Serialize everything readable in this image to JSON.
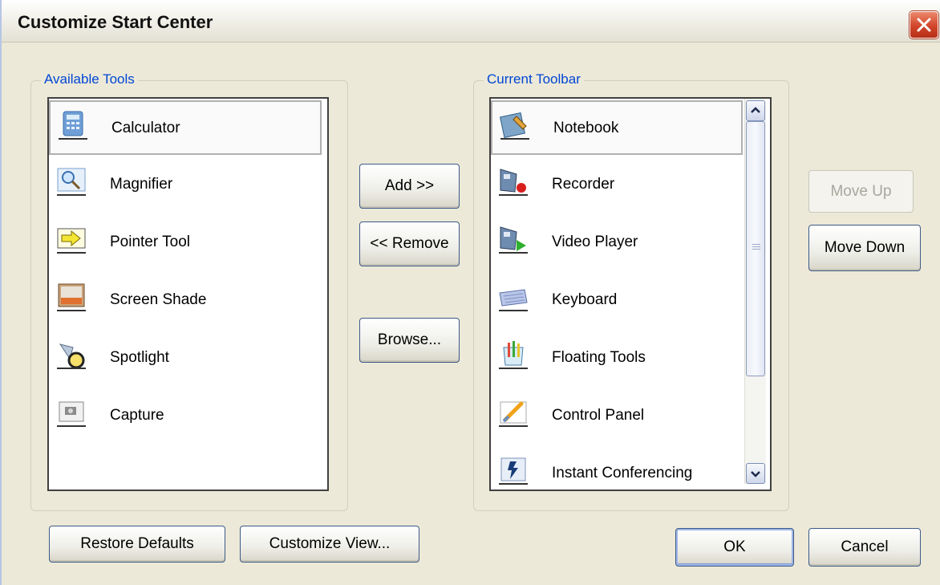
{
  "dialog": {
    "title": "Customize Start Center"
  },
  "available": {
    "legend": "Available Tools",
    "items": [
      {
        "label": "Calculator",
        "icon": "calculator-icon"
      },
      {
        "label": "Magnifier",
        "icon": "magnifier-icon"
      },
      {
        "label": "Pointer Tool",
        "icon": "pointer-tool-icon"
      },
      {
        "label": "Screen Shade",
        "icon": "screen-shade-icon"
      },
      {
        "label": "Spotlight",
        "icon": "spotlight-icon"
      },
      {
        "label": "Capture",
        "icon": "capture-icon"
      }
    ],
    "selected": "Calculator"
  },
  "current": {
    "legend": "Current Toolbar",
    "items": [
      {
        "label": "Notebook",
        "icon": "notebook-icon"
      },
      {
        "label": "Recorder",
        "icon": "recorder-icon"
      },
      {
        "label": "Video Player",
        "icon": "video-player-icon"
      },
      {
        "label": "Keyboard",
        "icon": "keyboard-icon"
      },
      {
        "label": "Floating Tools",
        "icon": "floating-tools-icon"
      },
      {
        "label": "Control Panel",
        "icon": "control-panel-icon"
      },
      {
        "label": "Instant Conferencing",
        "icon": "instant-conferencing-icon"
      }
    ],
    "selected": "Notebook"
  },
  "buttons": {
    "add": "Add >>",
    "remove": "<< Remove",
    "browse": "Browse...",
    "move_up": "Move Up",
    "move_down": "Move Down",
    "restore_defaults": "Restore Defaults",
    "customize_view": "Customize View...",
    "ok": "OK",
    "cancel": "Cancel"
  }
}
